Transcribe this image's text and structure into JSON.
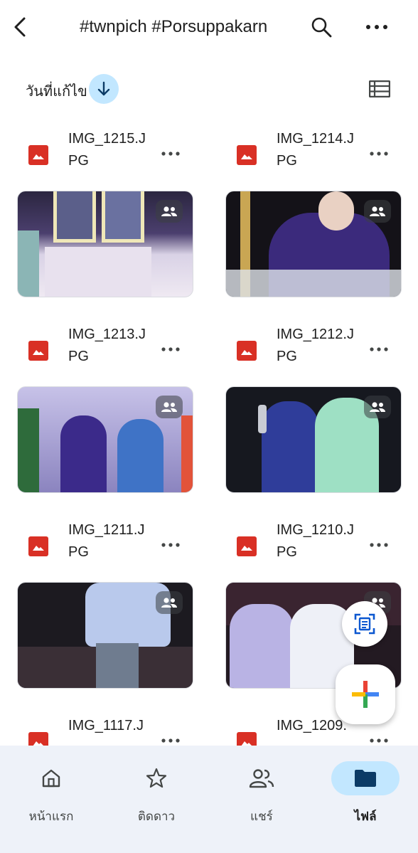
{
  "header": {
    "title": "#twnpich #Porsuppakarn",
    "back_icon": "back-arrow-icon",
    "search_icon": "search-icon",
    "more_icon": "more-horizontal-icon"
  },
  "sort": {
    "label": "วันที่แก้ไข",
    "direction_icon": "arrow-down-icon",
    "view_icon": "list-view-icon"
  },
  "files": [
    {
      "name": "IMG_1215.JPG",
      "shared": true
    },
    {
      "name": "IMG_1214.JPG",
      "shared": true
    },
    {
      "name": "IMG_1213.JPG",
      "shared": true
    },
    {
      "name": "IMG_1212.JPG",
      "shared": true
    },
    {
      "name": "IMG_1211.JPG",
      "shared": true
    },
    {
      "name": "IMG_1210.JPG",
      "shared": true
    },
    {
      "name": "IMG_1117.J",
      "shared": false
    },
    {
      "name": "IMG_1209.",
      "shared": false
    }
  ],
  "fab": {
    "scan_icon": "document-scan-icon",
    "new_icon": "plus-icon"
  },
  "bottom_nav": [
    {
      "label": "หน้าแรก",
      "icon": "home-icon",
      "active": false
    },
    {
      "label": "ติดดาว",
      "icon": "star-icon",
      "active": false
    },
    {
      "label": "แชร์",
      "icon": "people-icon",
      "active": false
    },
    {
      "label": "ไฟล์",
      "icon": "folder-icon",
      "active": true
    }
  ],
  "colors": {
    "accent_light": "#c2e7ff",
    "accent_dark": "#0b57d0",
    "image_file_red": "#d93025",
    "nav_bg": "#eef2f9"
  }
}
